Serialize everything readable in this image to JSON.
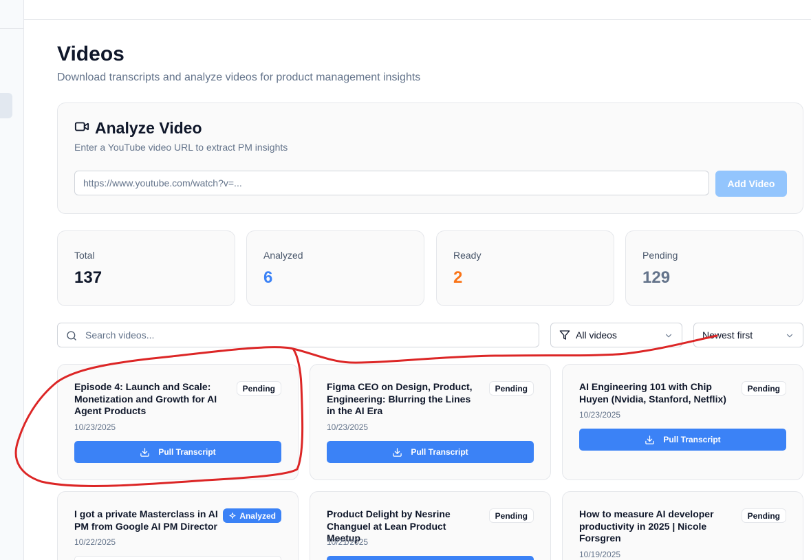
{
  "header": {
    "title": "Videos",
    "subtitle": "Download transcripts and analyze videos for product management insights"
  },
  "analyze": {
    "title": "Analyze Video",
    "description": "Enter a YouTube video URL to extract PM insights",
    "url_placeholder": "https://www.youtube.com/watch?v=...",
    "add_button": "Add Video"
  },
  "stats": [
    {
      "label": "Total",
      "value": "137",
      "color": "#0f172a"
    },
    {
      "label": "Analyzed",
      "value": "6",
      "color": "#3b82f6"
    },
    {
      "label": "Ready",
      "value": "2",
      "color": "#f97316"
    },
    {
      "label": "Pending",
      "value": "129",
      "color": "#64748b"
    }
  ],
  "filters": {
    "search_placeholder": "Search videos...",
    "status_filter": "All videos",
    "sort": "Newest first"
  },
  "videos": [
    {
      "title": "Episode 4: Launch and Scale: Monetization and Growth for AI Agent Products",
      "date": "10/23/2025",
      "status": "Pending",
      "action": "Pull Transcript"
    },
    {
      "title": "Figma CEO on Design, Product, Engineering: Blurring the Lines in the AI Era",
      "date": "10/23/2025",
      "status": "Pending",
      "action": "Pull Transcript"
    },
    {
      "title": "AI Engineering 101 with Chip Huyen (Nvidia, Stanford, Netflix)",
      "date": "10/23/2025",
      "status": "Pending",
      "action": "Pull Transcript"
    },
    {
      "title": "I got a private Masterclass in AI PM from Google AI PM Director",
      "date": "10/22/2025",
      "status": "Analyzed"
    },
    {
      "title": "Product Delight by Nesrine Changuel at Lean Product Meetup",
      "date": "10/21/2025",
      "status": "Pending"
    },
    {
      "title": "How to measure AI developer productivity in 2025 | Nicole Forsgren",
      "date": "10/19/2025",
      "status": "Pending"
    }
  ],
  "colors": {
    "accent": "#3b82f6",
    "accent_disabled": "#93c5fd",
    "annotation": "#dc2626"
  }
}
